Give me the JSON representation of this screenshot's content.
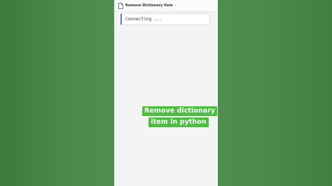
{
  "tab": {
    "title": "Remove Dictionary Item",
    "icon": "document-icon",
    "unsaved_indicator": "•"
  },
  "output": {
    "text": "Connecting ..."
  },
  "overlay_caption": {
    "line1": "Remove dictionary",
    "line2": "item in python",
    "highlight_color": "#49c13d"
  }
}
